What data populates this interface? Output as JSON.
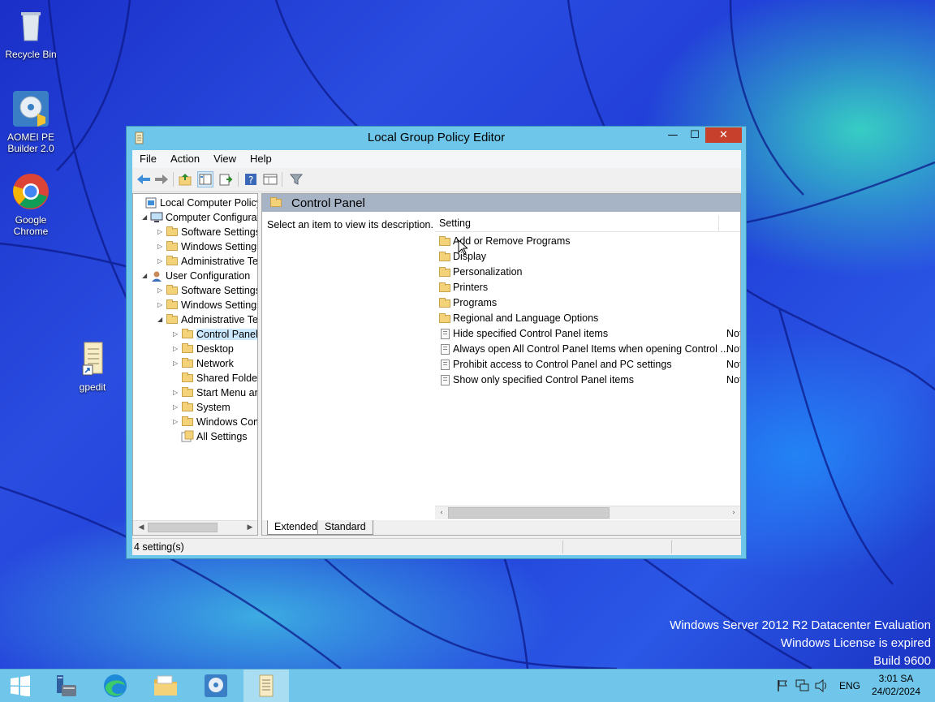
{
  "desktop": {
    "icons": [
      {
        "label": "Recycle Bin",
        "icon": "recycle-bin-icon"
      },
      {
        "label": "AOMEI PE Builder 2.0",
        "icon": "aomei-icon"
      },
      {
        "label": "Google Chrome",
        "icon": "chrome-icon"
      },
      {
        "label": "gpedit",
        "icon": "gpedit-shortcut-icon"
      }
    ],
    "watermark": {
      "line1": "Windows Server 2012 R2 Datacenter Evaluation",
      "line2": "Windows License is expired",
      "line3": "Build 9600"
    }
  },
  "window": {
    "title": "Local Group Policy Editor",
    "controls": {
      "minimize": "—",
      "maximize": "☐",
      "close": "✕"
    },
    "menu": [
      "File",
      "Action",
      "View",
      "Help"
    ],
    "tree": [
      {
        "label": "Local Computer Policy",
        "level": 0,
        "expander": "",
        "icon": "policy-icon"
      },
      {
        "label": "Computer Configuration",
        "level": 1,
        "expander": "◢",
        "icon": "computer-icon"
      },
      {
        "label": "Software Settings",
        "level": 2,
        "expander": "▷",
        "icon": "folder-icon"
      },
      {
        "label": "Windows Settings",
        "level": 2,
        "expander": "▷",
        "icon": "folder-icon"
      },
      {
        "label": "Administrative Templates",
        "level": 2,
        "expander": "▷",
        "icon": "folder-icon"
      },
      {
        "label": "User Configuration",
        "level": 1,
        "expander": "◢",
        "icon": "user-icon"
      },
      {
        "label": "Software Settings",
        "level": 2,
        "expander": "▷",
        "icon": "folder-icon"
      },
      {
        "label": "Windows Settings",
        "level": 2,
        "expander": "▷",
        "icon": "folder-icon"
      },
      {
        "label": "Administrative Templates",
        "level": 2,
        "expander": "◢",
        "icon": "folder-icon"
      },
      {
        "label": "Control Panel",
        "level": 3,
        "expander": "▷",
        "icon": "folder-icon",
        "selected": true
      },
      {
        "label": "Desktop",
        "level": 3,
        "expander": "▷",
        "icon": "folder-icon"
      },
      {
        "label": "Network",
        "level": 3,
        "expander": "▷",
        "icon": "folder-icon"
      },
      {
        "label": "Shared Folders",
        "level": 3,
        "expander": "",
        "icon": "folder-icon"
      },
      {
        "label": "Start Menu and Taskbar",
        "level": 3,
        "expander": "▷",
        "icon": "folder-icon"
      },
      {
        "label": "System",
        "level": 3,
        "expander": "▷",
        "icon": "folder-icon"
      },
      {
        "label": "Windows Components",
        "level": 3,
        "expander": "▷",
        "icon": "folder-icon"
      },
      {
        "label": "All Settings",
        "level": 3,
        "expander": "",
        "icon": "all-settings-icon"
      }
    ],
    "right": {
      "header": "Control Panel",
      "description": "Select an item to view its description.",
      "column_setting": "Setting",
      "rows": [
        {
          "label": "Add or Remove Programs",
          "type": "folder",
          "state": ""
        },
        {
          "label": "Display",
          "type": "folder",
          "state": ""
        },
        {
          "label": "Personalization",
          "type": "folder",
          "state": ""
        },
        {
          "label": "Printers",
          "type": "folder",
          "state": ""
        },
        {
          "label": "Programs",
          "type": "folder",
          "state": ""
        },
        {
          "label": "Regional and Language Options",
          "type": "folder",
          "state": ""
        },
        {
          "label": "Hide specified Control Panel items",
          "type": "policy",
          "state": "Not"
        },
        {
          "label": "Always open All Control Panel Items when opening Control ...",
          "type": "policy",
          "state": "Not"
        },
        {
          "label": "Prohibit access to Control Panel and PC settings",
          "type": "policy",
          "state": "Not"
        },
        {
          "label": "Show only specified Control Panel items",
          "type": "policy",
          "state": "Not"
        }
      ],
      "tabs": [
        "Extended",
        "Standard"
      ]
    },
    "status": "4 setting(s)"
  },
  "taskbar": {
    "items": [
      "start-icon",
      "server-manager-icon",
      "edge-icon",
      "file-explorer-icon",
      "aomei-icon",
      "gpedit-icon"
    ],
    "language": "ENG",
    "time": "3:01 SA",
    "date": "24/02/2024"
  },
  "colors": {
    "accent": "#6ec6ea",
    "close": "#c7402c",
    "selection": "#cce8ff"
  }
}
